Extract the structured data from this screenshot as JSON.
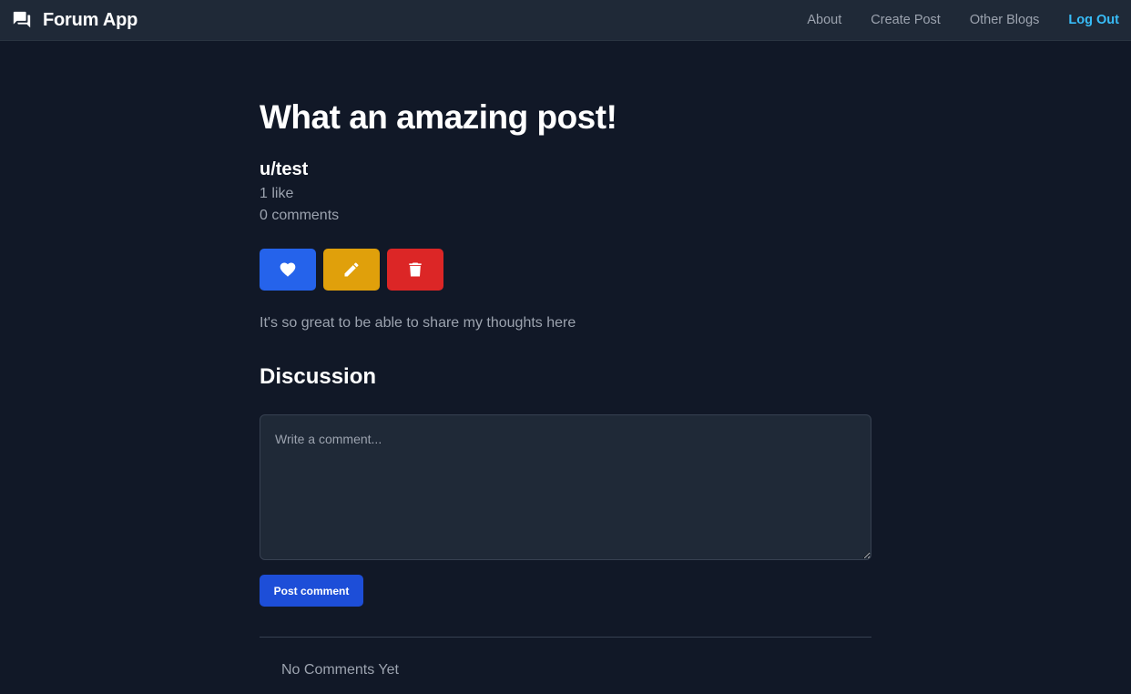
{
  "navbar": {
    "brand_icon": "chat-bubbles-icon",
    "brand_title": "Forum App",
    "links": [
      {
        "label": "About"
      },
      {
        "label": "Create Post"
      },
      {
        "label": "Other Blogs"
      }
    ],
    "logout_label": "Log Out",
    "logout_color": "#38bdf8"
  },
  "post": {
    "title": "What an amazing post!",
    "author": "u/test",
    "likes": "1 like",
    "comments_count": "0 comments",
    "body": "It's so great to be able to share my thoughts here",
    "actions": {
      "like_icon": "heart-icon",
      "like_color": "#2563eb",
      "edit_icon": "pencil-icon",
      "edit_color": "#e0a00b",
      "delete_icon": "trash-icon",
      "delete_color": "#dc2626"
    }
  },
  "discussion": {
    "heading": "Discussion",
    "comment_value": "",
    "comment_placeholder": "Write a comment...",
    "submit_label": "Post comment",
    "empty_message": "No Comments Yet"
  },
  "theme": {
    "background": "#111827",
    "navbar": "#1f2937",
    "accent": "#1d4ed8"
  }
}
